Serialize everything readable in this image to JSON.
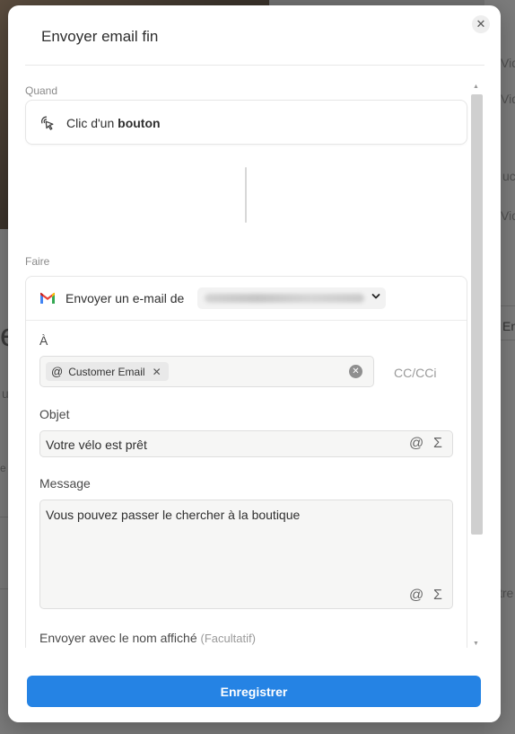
{
  "background": {
    "texts": [
      "Vid",
      "Vid",
      "Vid",
      "uc",
      "e",
      "u",
      "En",
      "e",
      "tre"
    ]
  },
  "modal": {
    "title": "Envoyer email fin",
    "close_icon": "close-icon"
  },
  "trigger": {
    "section_label": "Quand",
    "text_prefix": "Clic d'un ",
    "text_bold": "bouton",
    "icon": "click-pointer-icon"
  },
  "action": {
    "section_label": "Faire",
    "label": "Envoyer un e-mail de",
    "icon": "gmail-icon",
    "fields": {
      "to": {
        "label": "À",
        "chip_label": "Customer Email",
        "cc_label": "CC/CCi"
      },
      "subject": {
        "label": "Objet",
        "value": "Votre vélo est prêt"
      },
      "message": {
        "label": "Message",
        "value": "Vous pouvez passer le chercher à la boutique"
      },
      "display_name": {
        "label": "Envoyer avec le nom affiché",
        "optional": "(Facultatif)"
      }
    }
  },
  "footer": {
    "save_label": "Enregistrer"
  },
  "colors": {
    "primary": "#2583e4"
  }
}
